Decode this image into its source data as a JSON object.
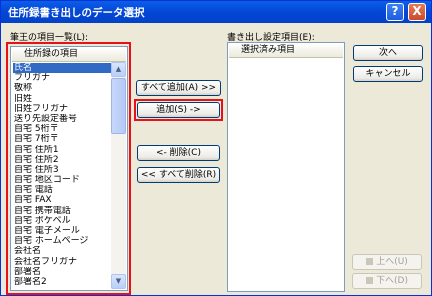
{
  "window": {
    "title": "住所録書き出しのデータ選択"
  },
  "titlebar": {
    "help_label": "?",
    "close_label": "X"
  },
  "left": {
    "label": "筆王の項目一覧(L):",
    "header": "住所録の項目",
    "items": [
      "氏名",
      "フリガナ",
      "敬称",
      "旧姓",
      "旧姓フリガナ",
      "送り先設定番号",
      "自宅 5桁〒",
      "自宅 7桁〒",
      "自宅 住所1",
      "自宅 住所2",
      "自宅 住所3",
      "自宅 地区コード",
      "自宅 電話",
      "自宅 FAX",
      "自宅 携帯電話",
      "自宅 ポケベル",
      "自宅 電子メール",
      "自宅 ホームページ",
      "会社名",
      "会社名フリガナ",
      "部署名",
      "部署名2"
    ],
    "selected_index": 0
  },
  "middle": {
    "add_all": "すべて追加(A) >>",
    "add": "追加(S) ->",
    "remove": "<- 削除(C)",
    "remove_all": "<< すべて削除(R)"
  },
  "right": {
    "label": "書き出し設定項目(E):",
    "header": "選択済み項目"
  },
  "side": {
    "next": "次へ",
    "cancel": "キャンセル",
    "up": "上へ(U)",
    "down": "下へ(D)"
  }
}
